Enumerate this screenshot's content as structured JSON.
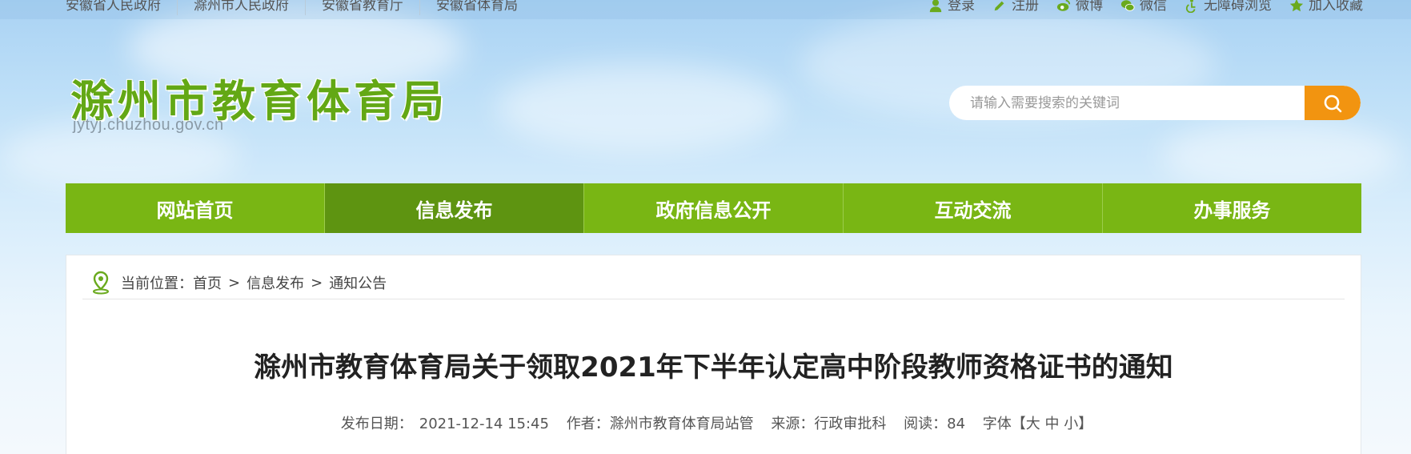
{
  "topbar": {
    "links": [
      "安徽省人民政府",
      "滁州市人民政府",
      "安徽省教育厅",
      "安徽省体育局"
    ],
    "actions": [
      {
        "label": "登录",
        "icon": "user-icon"
      },
      {
        "label": "注册",
        "icon": "pencil-icon"
      },
      {
        "label": "微博",
        "icon": "weibo-icon"
      },
      {
        "label": "微信",
        "icon": "wechat-icon"
      },
      {
        "label": "无障碍浏览",
        "icon": "accessibility-icon"
      },
      {
        "label": "加入收藏",
        "icon": "star-icon"
      }
    ]
  },
  "header": {
    "site_title": "滁州市教育体育局",
    "domain": "jytyj.chuzhou.gov.cn"
  },
  "search": {
    "placeholder": "请输入需要搜索的关键词"
  },
  "nav": {
    "items": [
      "网站首页",
      "信息发布",
      "政府信息公开",
      "互动交流",
      "办事服务"
    ],
    "active_index": 1
  },
  "breadcrumb": {
    "prefix": "当前位置：",
    "items": [
      "首页",
      "信息发布",
      "通知公告"
    ],
    "separator": ">"
  },
  "article": {
    "title": "滁州市教育体育局关于领取2021年下半年认定高中阶段教师资格证书的通知",
    "meta": {
      "date_label": "发布日期：",
      "date": "2021-12-14 15:45",
      "author_label": "作者：",
      "author": "滁州市教育体育局站管",
      "source_label": "来源：",
      "source": "行政审批科",
      "views_label": "阅读：",
      "views": "84",
      "font_label": "字体【大 中 小】"
    }
  },
  "colors": {
    "nav_green": "#79b614",
    "nav_active": "#5e9411",
    "title_green": "#63a815",
    "search_orange": "#f29410"
  }
}
